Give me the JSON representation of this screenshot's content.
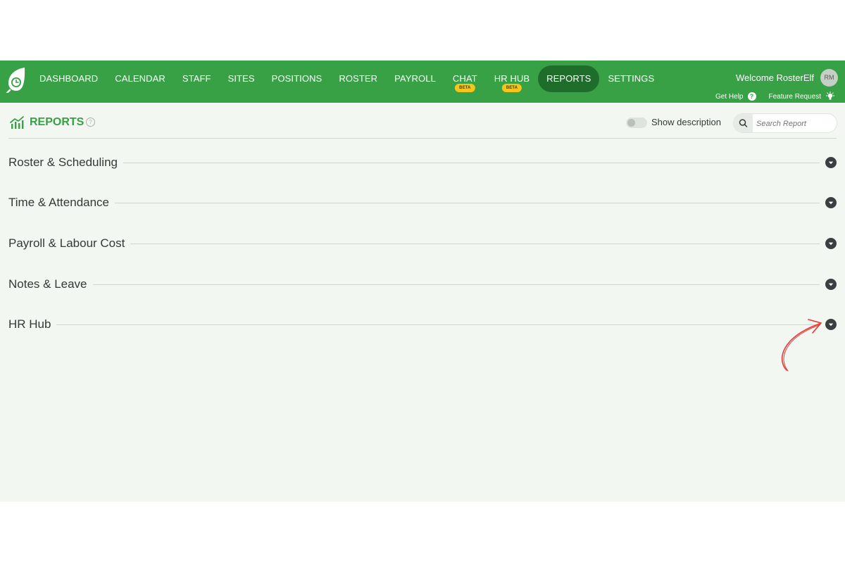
{
  "nav": {
    "items": [
      {
        "label": "DASHBOARD"
      },
      {
        "label": "CALENDAR"
      },
      {
        "label": "STAFF"
      },
      {
        "label": "SITES"
      },
      {
        "label": "POSITIONS"
      },
      {
        "label": "ROSTER"
      },
      {
        "label": "PAYROLL"
      },
      {
        "label": "CHAT",
        "badge": "BETA"
      },
      {
        "label": "HR HUB",
        "badge": "BETA"
      },
      {
        "label": "REPORTS",
        "active": true
      },
      {
        "label": "SETTINGS"
      }
    ],
    "welcome": "Welcome RosterElf",
    "avatar_initials": "RM",
    "get_help": "Get Help",
    "get_help_icon": "?",
    "feature_request": "Feature Request"
  },
  "reports": {
    "title": "REPORTS",
    "help_icon": "?",
    "show_description": "Show description",
    "show_description_on": false,
    "search_placeholder": "Search Report"
  },
  "sections": [
    {
      "label": "Roster & Scheduling"
    },
    {
      "label": "Time & Attendance"
    },
    {
      "label": "Payroll & Labour Cost"
    },
    {
      "label": "Notes & Leave"
    },
    {
      "label": "HR Hub"
    }
  ],
  "colors": {
    "brand_green": "#38a045",
    "active_nav": "#1f6d2a",
    "beta_badge": "#f5c518",
    "page_bg": "#f3f7f2",
    "annotation_red": "#e53935"
  },
  "icons": {
    "logo": "leaf-clock-logo",
    "reports": "bar-chart-trend-icon",
    "search": "search-icon",
    "feature_request": "lightbulb-icon",
    "section_toggle": "chevron-down-circle-icon"
  }
}
